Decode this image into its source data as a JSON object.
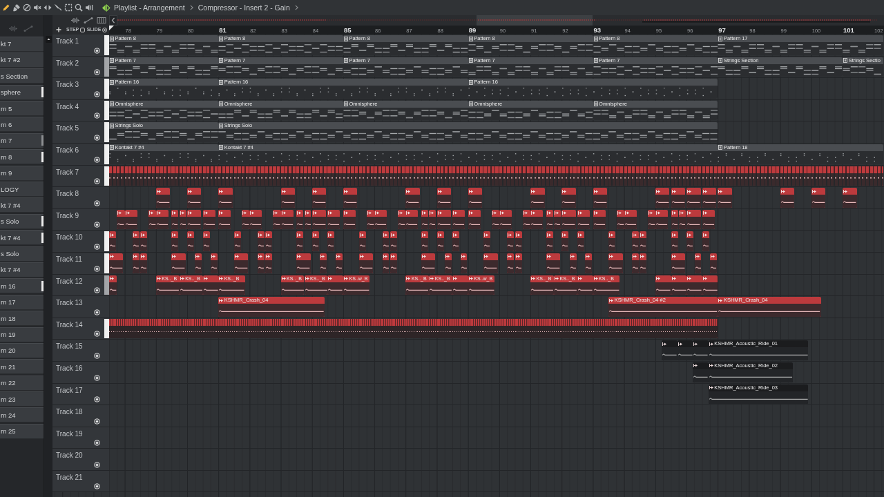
{
  "toolbar": {
    "tools": [
      {
        "kind": "pencil",
        "selected": true
      },
      {
        "kind": "paint",
        "selected": false
      },
      {
        "kind": "delete",
        "selected": false
      },
      {
        "kind": "mute",
        "selected": false
      },
      {
        "kind": "slip",
        "selected": false
      },
      {
        "kind": "slice",
        "selected": false
      },
      {
        "kind": "select",
        "selected": false
      },
      {
        "kind": "zoom",
        "selected": false
      },
      {
        "kind": "playback",
        "selected": false
      }
    ]
  },
  "title": {
    "window": "Playlist - Arrangement",
    "path": [
      "Compressor - Insert 2 - Gain"
    ]
  },
  "picker": {
    "items": [
      {
        "label": "kt 7"
      },
      {
        "label": "kt 7 #2"
      },
      {
        "label": "s Section"
      },
      {
        "label": "sphere",
        "color": "#eeeeee"
      },
      {
        "label": "rn 5"
      },
      {
        "label": "rn 6"
      },
      {
        "label": "rn 7",
        "color": "#8d8f92"
      },
      {
        "label": "rn 8",
        "color": "#eeeeee"
      },
      {
        "label": "rn 9"
      },
      {
        "label": "LOGY"
      },
      {
        "label": "kt 7 #4"
      },
      {
        "label": "s Solo",
        "color": "#eeeeee"
      },
      {
        "label": "kt 7 #4",
        "color": "#eeeeee"
      },
      {
        "label": "s Solo"
      },
      {
        "label": "kt 7 #4"
      },
      {
        "label": "rn 16",
        "color": "#eeeeee"
      },
      {
        "label": "rn 17"
      },
      {
        "label": "rn 18"
      },
      {
        "label": "rn 19"
      },
      {
        "label": "rn 20"
      },
      {
        "label": "rn 21"
      },
      {
        "label": "rn 22"
      },
      {
        "label": "rn 23"
      },
      {
        "label": "rn 24"
      },
      {
        "label": "rn 25"
      }
    ]
  },
  "snap": [
    {
      "label": "STEP",
      "kind": "square"
    },
    {
      "label": "SLIDE",
      "kind": "radio"
    }
  ],
  "ruler": {
    "bars": [
      {
        "label": "78",
        "major": false
      },
      {
        "label": "79",
        "major": false
      },
      {
        "label": "80",
        "major": false
      },
      {
        "label": "81",
        "major": true
      },
      {
        "label": "82",
        "major": false
      },
      {
        "label": "83",
        "major": false
      },
      {
        "label": "84",
        "major": false
      },
      {
        "label": "85",
        "major": true
      },
      {
        "label": "86",
        "major": false
      },
      {
        "label": "87",
        "major": false
      },
      {
        "label": "88",
        "major": false
      },
      {
        "label": "89",
        "major": true
      },
      {
        "label": "90",
        "major": false
      },
      {
        "label": "91",
        "major": false
      },
      {
        "label": "92",
        "major": false
      },
      {
        "label": "93",
        "major": true
      },
      {
        "label": "94",
        "major": false
      },
      {
        "label": "95",
        "major": false
      },
      {
        "label": "96",
        "major": false
      },
      {
        "label": "97",
        "major": true
      },
      {
        "label": "98",
        "major": false
      },
      {
        "label": "99",
        "major": false
      },
      {
        "label": "100",
        "major": false
      },
      {
        "label": "101",
        "major": true
      },
      {
        "label": "102",
        "major": false
      }
    ]
  },
  "tracks": [
    {
      "name": "Track 1",
      "enabled": true,
      "color": "#f0f0f0",
      "clips": [
        {
          "kind": "pattern",
          "color": "#4a4d51",
          "label": "Pattern 8"
        },
        {
          "kind": "pattern",
          "color": "#4a4d51",
          "label": "Pattern 8"
        },
        {
          "kind": "pattern",
          "color": "#4a4d51",
          "label": "Pattern 8"
        },
        {
          "kind": "pattern",
          "color": "#4a4d51",
          "label": "Pattern 8"
        },
        {
          "kind": "pattern",
          "color": "#4a4d51",
          "label": "Pattern 8"
        },
        {
          "kind": "pattern",
          "color": "#4a4d51",
          "label": "Pattern 17"
        }
      ]
    },
    {
      "name": "Track 2",
      "enabled": true,
      "color": "#a3a5a8",
      "clips": [
        {
          "kind": "pattern",
          "color": "#4a4d51",
          "label": "Pattern 7"
        },
        {
          "kind": "pattern",
          "color": "#4a4d51",
          "label": "Pattern 7"
        },
        {
          "kind": "pattern",
          "color": "#4a4d51",
          "label": "Pattern 7"
        },
        {
          "kind": "pattern",
          "color": "#4a4d51",
          "label": "Pattern 7"
        },
        {
          "kind": "pattern",
          "color": "#4a4d51",
          "label": "Pattern 7"
        },
        {
          "kind": "pattern",
          "color": "#4a4d51",
          "label": "Strings Section"
        },
        {
          "kind": "pattern",
          "color": "#4a4d51",
          "label": "Strings Sectio"
        }
      ]
    },
    {
      "name": "Track 3",
      "enabled": true,
      "color": "#f0f0f0",
      "clips": [
        {
          "kind": "pattern",
          "color": "#4a4d51",
          "label": "Pattern 16"
        },
        {
          "kind": "pattern",
          "color": "#4a4d51",
          "label": "Pattern 16"
        },
        {
          "kind": "pattern",
          "color": "#4a4d51",
          "label": "Pattern 16"
        }
      ]
    },
    {
      "name": "Track 4",
      "enabled": true,
      "color": "#f0f0f0",
      "clips": [
        {
          "kind": "pattern",
          "color": "#4a4d51",
          "label": "Omnisphere"
        },
        {
          "kind": "pattern",
          "color": "#4a4d51",
          "label": "Omnisphere"
        },
        {
          "kind": "pattern",
          "color": "#4a4d51",
          "label": "Omnisphere"
        },
        {
          "kind": "pattern",
          "color": "#4a4d51",
          "label": "Omnisphere"
        },
        {
          "kind": "pattern",
          "color": "#4a4d51",
          "label": "Omnisphere"
        }
      ]
    },
    {
      "name": "Track 5",
      "enabled": true,
      "color": "#f0f0f0",
      "clips": [
        {
          "kind": "pattern",
          "color": "#4a4d51",
          "label": "Strings Solo"
        },
        {
          "kind": "pattern",
          "color": "#4a4d51",
          "label": "Strings Solo"
        }
      ]
    },
    {
      "name": "Track 6",
      "enabled": true,
      "color": "#f0f0f0",
      "clips": [
        {
          "kind": "pattern",
          "color": "#4a4d51",
          "label": "Kontakt 7 #4"
        },
        {
          "kind": "pattern",
          "color": "#4a4d51",
          "label": "Kontakt 7 #4"
        },
        {
          "kind": "pattern",
          "color": "#4a4d51",
          "label": "Pattern 18"
        }
      ]
    },
    {
      "name": "Track 7",
      "enabled": true,
      "color": "#f0f0f0",
      "clips": [
        {
          "kind": "hits",
          "color": "#bd3a3d"
        }
      ]
    },
    {
      "name": "Track 8",
      "enabled": true,
      "clips": [
        {
          "kind": "audio",
          "color": "#bd3a3d"
        },
        {
          "kind": "audio",
          "color": "#bd3a3d"
        },
        {
          "kind": "audio",
          "color": "#bd3a3d"
        },
        {
          "kind": "audio",
          "color": "#bd3a3d"
        },
        {
          "kind": "audio",
          "color": "#bd3a3d"
        },
        {
          "kind": "audio",
          "color": "#bd3a3d"
        },
        {
          "kind": "audio",
          "color": "#bd3a3d"
        },
        {
          "kind": "audio",
          "color": "#bd3a3d"
        },
        {
          "kind": "audio",
          "color": "#bd3a3d"
        },
        {
          "kind": "audio",
          "color": "#bd3a3d"
        },
        {
          "kind": "audio",
          "color": "#bd3a3d"
        },
        {
          "kind": "audio",
          "color": "#bd3a3d"
        },
        {
          "kind": "audio",
          "color": "#bd3a3d"
        },
        {
          "kind": "audio",
          "color": "#bd3a3d"
        },
        {
          "kind": "audio",
          "color": "#bd3a3d"
        },
        {
          "kind": "audio",
          "color": "#bd3a3d"
        },
        {
          "kind": "audio",
          "color": "#bd3a3d"
        },
        {
          "kind": "audio",
          "color": "#bd3a3d"
        },
        {
          "kind": "audio",
          "color": "#bd3a3d"
        },
        {
          "kind": "audio",
          "color": "#bd3a3d"
        }
      ]
    },
    {
      "name": "Track 9",
      "enabled": true,
      "clips": [
        {
          "kind": "audio",
          "color": "#bd3a3d"
        },
        {
          "kind": "audio",
          "color": "#bd3a3d"
        },
        {
          "kind": "audio",
          "color": "#bd3a3d"
        },
        {
          "kind": "audio",
          "color": "#bd3a3d"
        },
        {
          "kind": "audio",
          "color": "#bd3a3d"
        },
        {
          "kind": "audio",
          "color": "#bd3a3d"
        },
        {
          "kind": "audio",
          "color": "#bd3a3d"
        },
        {
          "kind": "audio",
          "color": "#bd3a3d"
        },
        {
          "kind": "audio",
          "color": "#bd3a3d"
        },
        {
          "kind": "audio",
          "color": "#bd3a3d"
        },
        {
          "kind": "audio",
          "color": "#bd3a3d"
        },
        {
          "kind": "audio",
          "color": "#bd3a3d"
        },
        {
          "kind": "audio",
          "color": "#bd3a3d"
        },
        {
          "kind": "audio",
          "color": "#bd3a3d"
        },
        {
          "kind": "audio",
          "color": "#bd3a3d"
        },
        {
          "kind": "audio",
          "color": "#bd3a3d"
        },
        {
          "kind": "audio",
          "color": "#bd3a3d"
        },
        {
          "kind": "audio",
          "color": "#bd3a3d"
        },
        {
          "kind": "audio",
          "color": "#bd3a3d"
        },
        {
          "kind": "audio",
          "color": "#bd3a3d"
        },
        {
          "kind": "audio",
          "color": "#bd3a3d"
        },
        {
          "kind": "audio",
          "color": "#bd3a3d"
        },
        {
          "kind": "audio",
          "color": "#bd3a3d"
        },
        {
          "kind": "audio",
          "color": "#bd3a3d"
        },
        {
          "kind": "audio",
          "color": "#bd3a3d"
        },
        {
          "kind": "audio",
          "color": "#bd3a3d"
        },
        {
          "kind": "audio",
          "color": "#bd3a3d"
        },
        {
          "kind": "audio",
          "color": "#bd3a3d"
        },
        {
          "kind": "audio",
          "color": "#bd3a3d"
        },
        {
          "kind": "audio",
          "color": "#bd3a3d"
        },
        {
          "kind": "audio",
          "color": "#bd3a3d"
        },
        {
          "kind": "audio",
          "color": "#bd3a3d"
        },
        {
          "kind": "audio",
          "color": "#bd3a3d"
        },
        {
          "kind": "audio",
          "color": "#bd3a3d"
        },
        {
          "kind": "audio",
          "color": "#bd3a3d"
        },
        {
          "kind": "audio",
          "color": "#bd3a3d"
        },
        {
          "kind": "audio",
          "color": "#bd3a3d"
        },
        {
          "kind": "audio",
          "color": "#bd3a3d"
        },
        {
          "kind": "audio",
          "color": "#bd3a3d"
        },
        {
          "kind": "audio",
          "color": "#bd3a3d"
        },
        {
          "kind": "audio",
          "color": "#bd3a3d"
        },
        {
          "kind": "audio",
          "color": "#bd3a3d"
        },
        {
          "kind": "audio",
          "color": "#bd3a3d"
        },
        {
          "kind": "audio",
          "color": "#bd3a3d"
        }
      ]
    },
    {
      "name": "Track 10",
      "enabled": true,
      "color": "#f0f0f0",
      "clips": [
        {
          "kind": "audio",
          "color": "#bd3a3d"
        },
        {
          "kind": "audio",
          "color": "#bd3a3d"
        },
        {
          "kind": "audio",
          "color": "#bd3a3d"
        },
        {
          "kind": "audio",
          "color": "#bd3a3d"
        },
        {
          "kind": "audio",
          "color": "#bd3a3d"
        },
        {
          "kind": "audio",
          "color": "#bd3a3d"
        },
        {
          "kind": "audio",
          "color": "#bd3a3d"
        },
        {
          "kind": "audio",
          "color": "#bd3a3d"
        },
        {
          "kind": "audio",
          "color": "#bd3a3d"
        },
        {
          "kind": "audio",
          "color": "#bd3a3d"
        },
        {
          "kind": "audio",
          "color": "#bd3a3d"
        },
        {
          "kind": "audio",
          "color": "#bd3a3d"
        },
        {
          "kind": "audio",
          "color": "#bd3a3d"
        },
        {
          "kind": "audio",
          "color": "#bd3a3d"
        },
        {
          "kind": "audio",
          "color": "#bd3a3d"
        },
        {
          "kind": "audio",
          "color": "#bd3a3d"
        },
        {
          "kind": "audio",
          "color": "#bd3a3d"
        },
        {
          "kind": "audio",
          "color": "#bd3a3d"
        },
        {
          "kind": "audio",
          "color": "#bd3a3d"
        },
        {
          "kind": "audio",
          "color": "#bd3a3d"
        },
        {
          "kind": "audio",
          "color": "#bd3a3d"
        },
        {
          "kind": "audio",
          "color": "#bd3a3d"
        },
        {
          "kind": "audio",
          "color": "#bd3a3d"
        },
        {
          "kind": "audio",
          "color": "#bd3a3d"
        },
        {
          "kind": "audio",
          "color": "#bd3a3d"
        },
        {
          "kind": "audio",
          "color": "#bd3a3d"
        },
        {
          "kind": "audio",
          "color": "#bd3a3d"
        },
        {
          "kind": "audio",
          "color": "#bd3a3d"
        },
        {
          "kind": "audio",
          "color": "#bd3a3d"
        },
        {
          "kind": "audio",
          "color": "#bd3a3d"
        }
      ]
    },
    {
      "name": "Track 11",
      "enabled": true,
      "color": "#f0f0f0",
      "clips": [
        {
          "kind": "audio",
          "color": "#bd3a3d"
        },
        {
          "kind": "audio",
          "color": "#bd3a3d"
        },
        {
          "kind": "audio",
          "color": "#bd3a3d"
        },
        {
          "kind": "audio",
          "color": "#bd3a3d"
        },
        {
          "kind": "audio",
          "color": "#bd3a3d"
        },
        {
          "kind": "audio",
          "color": "#bd3a3d"
        },
        {
          "kind": "audio",
          "color": "#bd3a3d"
        },
        {
          "kind": "audio",
          "color": "#bd3a3d"
        },
        {
          "kind": "audio",
          "color": "#bd3a3d"
        },
        {
          "kind": "audio",
          "color": "#bd3a3d"
        },
        {
          "kind": "audio",
          "color": "#bd3a3d"
        },
        {
          "kind": "audio",
          "color": "#bd3a3d"
        },
        {
          "kind": "audio",
          "color": "#bd3a3d"
        },
        {
          "kind": "audio",
          "color": "#bd3a3d"
        },
        {
          "kind": "audio",
          "color": "#bd3a3d"
        },
        {
          "kind": "audio",
          "color": "#bd3a3d"
        },
        {
          "kind": "audio",
          "color": "#bd3a3d"
        },
        {
          "kind": "audio",
          "color": "#bd3a3d"
        },
        {
          "kind": "audio",
          "color": "#bd3a3d"
        },
        {
          "kind": "audio",
          "color": "#bd3a3d"
        },
        {
          "kind": "audio",
          "color": "#bd3a3d"
        },
        {
          "kind": "audio",
          "color": "#bd3a3d"
        },
        {
          "kind": "audio",
          "color": "#bd3a3d"
        },
        {
          "kind": "audio",
          "color": "#bd3a3d"
        },
        {
          "kind": "audio",
          "color": "#bd3a3d"
        },
        {
          "kind": "audio",
          "color": "#bd3a3d"
        },
        {
          "kind": "audio",
          "color": "#bd3a3d"
        },
        {
          "kind": "audio",
          "color": "#bd3a3d"
        },
        {
          "kind": "audio",
          "color": "#bd3a3d"
        },
        {
          "kind": "audio",
          "color": "#bd3a3d"
        }
      ]
    },
    {
      "name": "Track 12",
      "enabled": true,
      "color": "#a3a5a8",
      "clips": [
        {
          "kind": "audio",
          "color": "#bd3a3d"
        },
        {
          "kind": "audio",
          "color": "#bd3a3d",
          "label": "KS.._B"
        },
        {
          "kind": "audio",
          "color": "#bd3a3d",
          "label": "KS.._B"
        },
        {
          "kind": "audio",
          "color": "#bd3a3d"
        },
        {
          "kind": "audio",
          "color": "#bd3a3d",
          "label": "KS.._B"
        },
        {
          "kind": "audio",
          "color": "#bd3a3d",
          "label": "KS.._B"
        },
        {
          "kind": "audio",
          "color": "#bd3a3d",
          "label": "KS.._B"
        },
        {
          "kind": "audio",
          "color": "#bd3a3d"
        },
        {
          "kind": "audio",
          "color": "#bd3a3d",
          "label": "KS..w_B"
        },
        {
          "kind": "audio",
          "color": "#bd3a3d",
          "label": "KS.._B"
        },
        {
          "kind": "audio",
          "color": "#bd3a3d",
          "label": "KS.._B"
        },
        {
          "kind": "audio",
          "color": "#bd3a3d"
        },
        {
          "kind": "audio",
          "color": "#bd3a3d",
          "label": "KS..w_B"
        },
        {
          "kind": "audio",
          "color": "#bd3a3d",
          "label": "KS.._B"
        },
        {
          "kind": "audio",
          "color": "#bd3a3d",
          "label": "KS.._B"
        },
        {
          "kind": "audio",
          "color": "#bd3a3d"
        },
        {
          "kind": "audio",
          "color": "#bd3a3d",
          "label": "KS.._B"
        },
        {
          "kind": "audio",
          "color": "#bd3a3d"
        },
        {
          "kind": "audio",
          "color": "#bd3a3d"
        },
        {
          "kind": "audio",
          "color": "#bd3a3d"
        },
        {
          "kind": "audio",
          "color": "#bd3a3d"
        }
      ]
    },
    {
      "name": "Track 13",
      "enabled": true,
      "clips": [
        {
          "kind": "audio",
          "color": "#bd3a3d",
          "label": "KSHMR_Crash_04"
        },
        {
          "kind": "audio",
          "color": "#bd3a3d",
          "label": "KSHMR_Crash_04 #2"
        },
        {
          "kind": "audio",
          "color": "#bd3a3d",
          "label": "KSHMR_Crash_04"
        }
      ]
    },
    {
      "name": "Track 14",
      "enabled": true,
      "color": "#f0f0f0",
      "clips": [
        {
          "kind": "roll",
          "color": "#bd3a3d"
        }
      ]
    },
    {
      "name": "Track 15",
      "enabled": true,
      "clips": [
        {
          "kind": "audio",
          "color": "#1b1c1e"
        },
        {
          "kind": "audio",
          "color": "#1b1c1e"
        },
        {
          "kind": "audio",
          "color": "#1b1c1e"
        },
        {
          "kind": "audio",
          "color": "#1b1c1e",
          "label": "KSHMR_Acoustic_Ride_01"
        }
      ]
    },
    {
      "name": "Track 16",
      "enabled": true,
      "clips": [
        {
          "kind": "audio",
          "color": "#1b1c1e"
        },
        {
          "kind": "audio",
          "color": "#1b1c1e",
          "label": "KSHMR_Acoustic_Ride_02"
        }
      ]
    },
    {
      "name": "Track 17",
      "enabled": true,
      "clips": [
        {
          "kind": "audio",
          "color": "#1b1c1e",
          "label": "KSHMR_Acoustic_Ride_03"
        }
      ]
    },
    {
      "name": "Track 18",
      "enabled": true
    },
    {
      "name": "Track 19",
      "enabled": true
    },
    {
      "name": "Track 20",
      "enabled": true
    },
    {
      "name": "Track 21",
      "enabled": true
    }
  ]
}
